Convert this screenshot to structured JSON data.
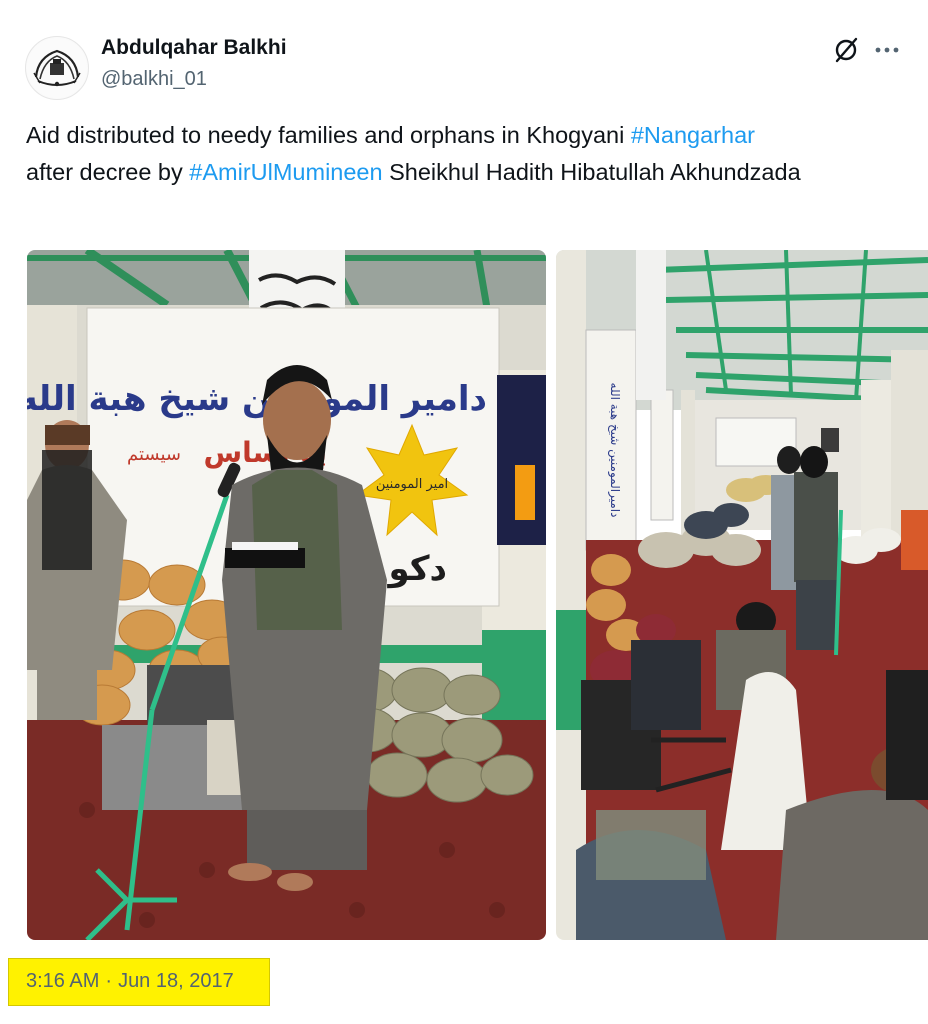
{
  "author": {
    "display_name": "Abdulqahar Balkhi",
    "handle": "@balkhi_01",
    "avatar_icon": "emblem-avatar"
  },
  "actions": {
    "grok_icon": "grok-icon",
    "more_icon": "more-icon"
  },
  "tweet": {
    "text_1": "Aid distributed to needy families and orphans in Khogyani ",
    "hashtag_1": "#Nangarhar",
    "text_2": " after decree by ",
    "hashtag_2": "#AmirUlMumineen",
    "text_3": " Sheikhul Hadith Hibatullah Akhundzada"
  },
  "media": {
    "banner_line_1": "دامیر المومنین شیخ هبة الله اخندزاده",
    "banner_line_2": "په اساس",
    "banner_line_3": "دکو",
    "badge_text": "امیر المومنین",
    "right_banner": "دامیرالمومنین شیخ هبة الله"
  },
  "meta": {
    "time": "3:16 AM",
    "separator": "·",
    "date": "Jun 18, 2017"
  },
  "colors": {
    "link": "#1d9bf0",
    "muted": "#536471",
    "highlight": "#fff200",
    "green": "#2fa36b"
  }
}
